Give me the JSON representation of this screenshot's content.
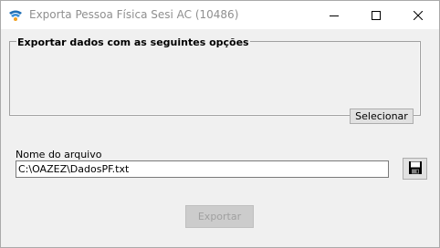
{
  "window": {
    "title": "Exporta Pessoa Física Sesi AC (10486)",
    "controls": {
      "minimize_icon": "minimize-icon",
      "maximize_icon": "maximize-icon",
      "close_icon": "close-icon"
    }
  },
  "options_group": {
    "legend": "Exportar dados com as seguintes opções",
    "select_label": "Selecionar"
  },
  "file": {
    "label": "Nome do arquivo",
    "value": "C:\\OAZEZ\\DadosPF.txt",
    "save_icon": "floppy-disk-icon"
  },
  "actions": {
    "export_label": "Exportar",
    "export_enabled": false
  }
}
